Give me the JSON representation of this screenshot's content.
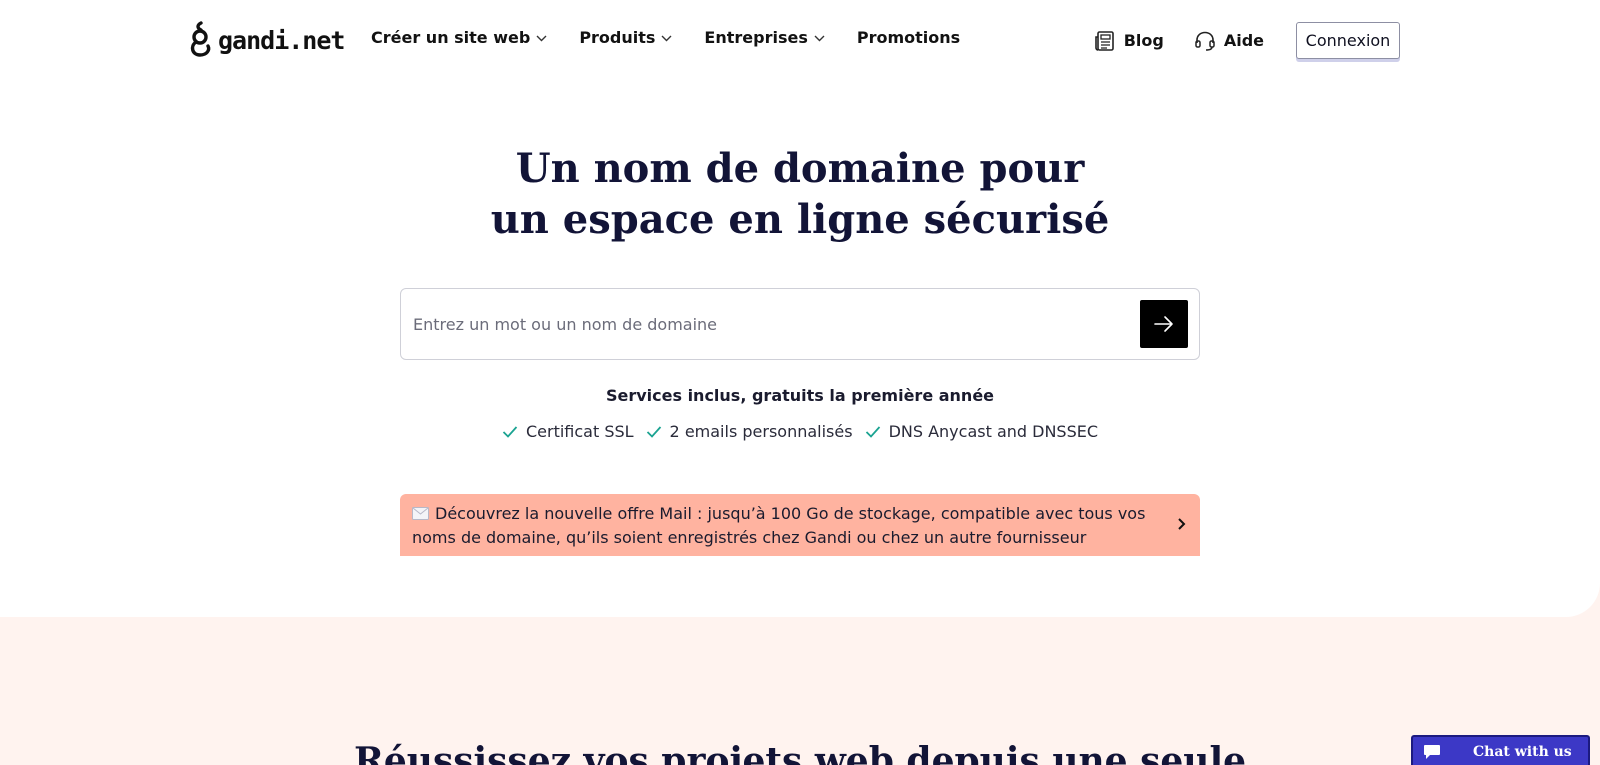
{
  "header": {
    "logo_text": "gandi.net",
    "nav": [
      {
        "label": "Créer un site web",
        "has_dropdown": true
      },
      {
        "label": "Produits",
        "has_dropdown": true
      },
      {
        "label": "Entreprises",
        "has_dropdown": true
      },
      {
        "label": "Promotions",
        "has_dropdown": false
      }
    ],
    "blog_label": "Blog",
    "help_label": "Aide",
    "login_label": "Connexion"
  },
  "hero": {
    "title_line1": "Un nom de domaine pour",
    "title_line2": "un espace en ligne sécurisé",
    "search_placeholder": "Entrez un mot ou un nom de domaine",
    "services_heading": "Services inclus, gratuits la première année",
    "features": [
      "Certificat SSL",
      "2 emails personnalisés",
      "DNS Anycast and DNSSEC"
    ],
    "promo_text": "Découvrez la nouvelle offre Mail : jusqu’à 100 Go de stockage, compatible avec tous vos noms de domaine, qu’ils soient enregistrés chez Gandi ou chez un autre fournisseur"
  },
  "next_section": {
    "title": "Réussissez vos projets web depuis une seule"
  },
  "chat": {
    "label": "Chat with us"
  },
  "colors": {
    "title": "#121437",
    "promo_bg": "#ffb3a0",
    "page_bg_lower": "#fff3ef",
    "check": "#1aa391",
    "chat_bg": "#3c38c6"
  },
  "icons": [
    "gandi-logo-icon",
    "chevron-down-icon",
    "newspaper-icon",
    "headset-icon",
    "arrow-right-icon",
    "check-icon",
    "envelope-icon",
    "chevron-right-icon",
    "chat-bubble-icon"
  ]
}
